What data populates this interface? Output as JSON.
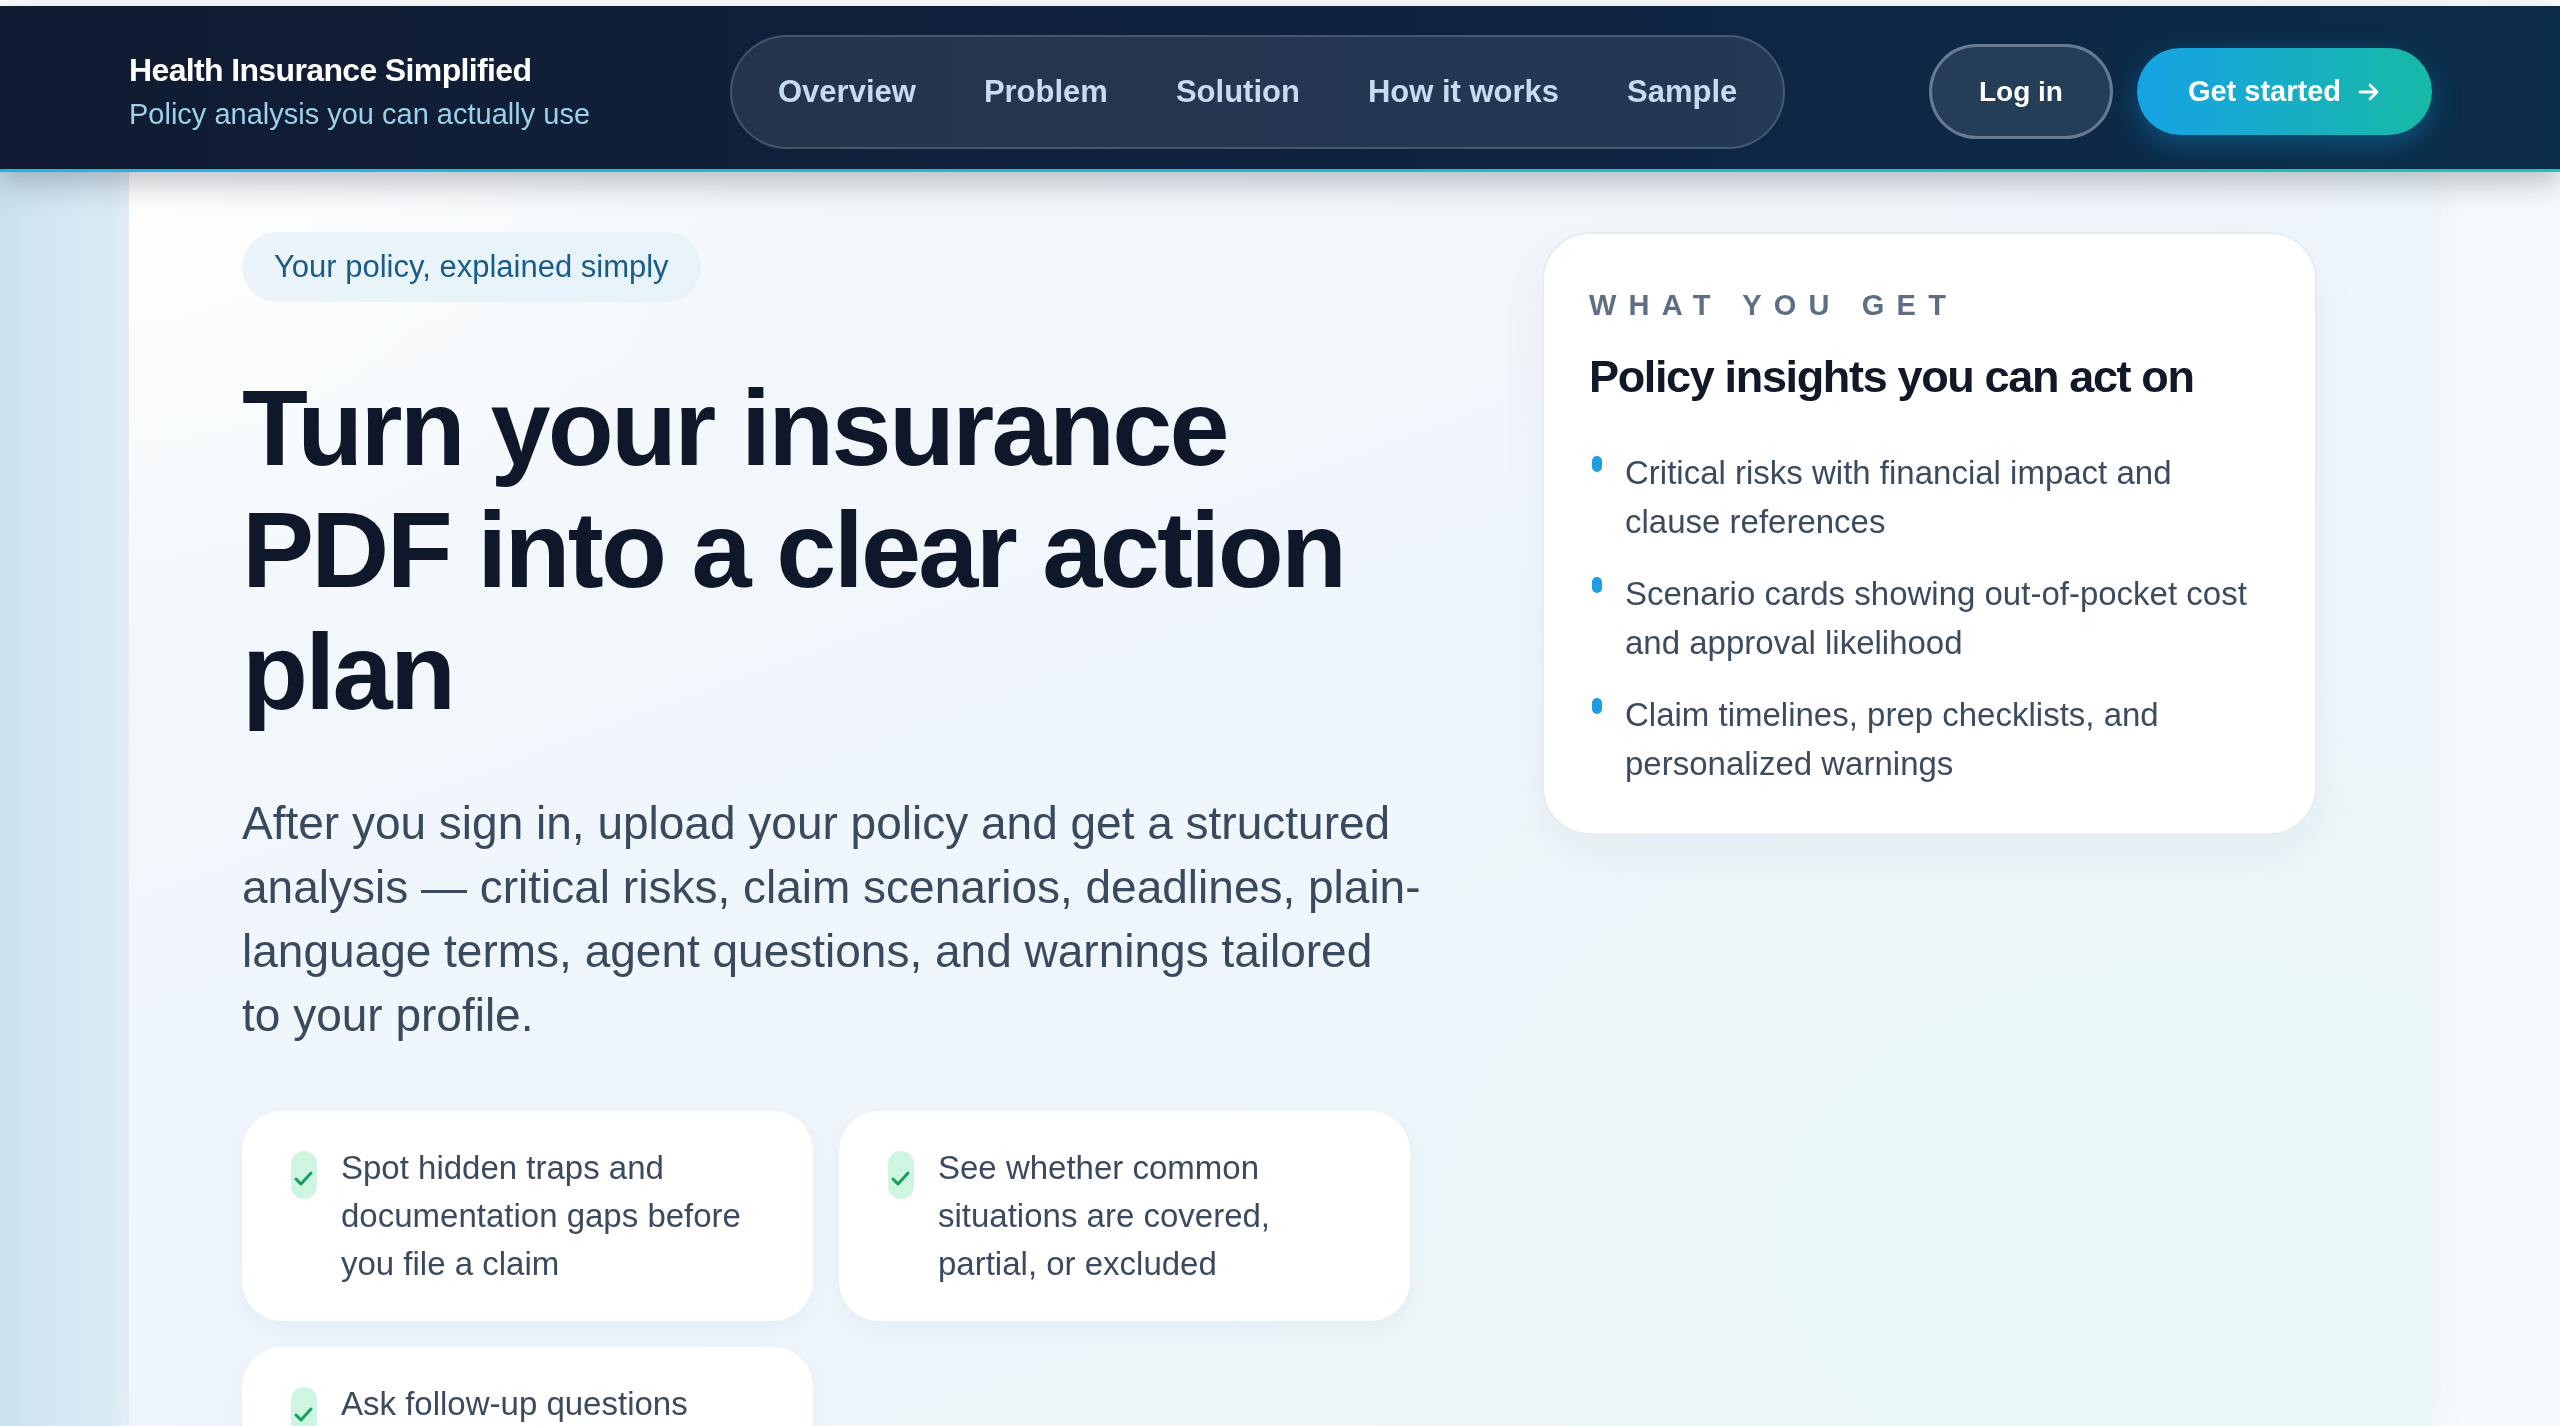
{
  "header": {
    "brand_title": "Health Insurance Simplified",
    "brand_subtitle": "Policy analysis you can actually use",
    "nav": [
      "Overview",
      "Problem",
      "Solution",
      "How it works",
      "Sample"
    ],
    "buttons": [
      {
        "label": "Log in",
        "kind": "secondary"
      },
      {
        "label": "Get started",
        "kind": "primary"
      }
    ]
  },
  "hero": {
    "badge": "Your policy, explained simply",
    "headline": "Turn your insurance PDF into a clear action plan",
    "intro": "After you sign in, upload your policy and get a structured analysis — critical risks, claim scenarios, deadlines, plain-language terms, agent questions, and warnings tailored to your profile.",
    "features": [
      "Spot hidden traps and documentation gaps before you file a claim",
      "See whether common situations are covered, partial, or excluded",
      "Ask follow-up questions"
    ]
  },
  "insights_card": {
    "eyebrow": "WHAT YOU GET",
    "title": "Policy insights you can act on",
    "items": [
      "Critical risks with financial impact and clause references",
      "Scenario cards showing out-of-pocket cost and approval likelihood",
      "Claim timelines, prep checklists, and personalized warnings"
    ]
  }
}
